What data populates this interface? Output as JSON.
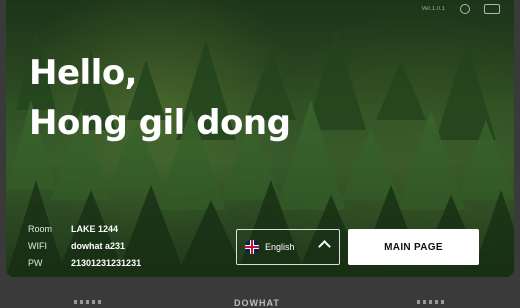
{
  "top": {
    "version": "Ver.1.0.1"
  },
  "greeting": {
    "line1": "Hello,",
    "line2": "Hong gil dong"
  },
  "info": {
    "room_label": "Room",
    "room_value": "LAKE 1244",
    "wifi_label": "WIFI",
    "wifi_value": "dowhat a231",
    "pw_label": "PW",
    "pw_value": "21301231231231"
  },
  "language": {
    "label": "English",
    "icon": "uk-flag-icon"
  },
  "main_button": {
    "label": "MAIN PAGE"
  },
  "footer": {
    "brand": "DOWHAT"
  }
}
